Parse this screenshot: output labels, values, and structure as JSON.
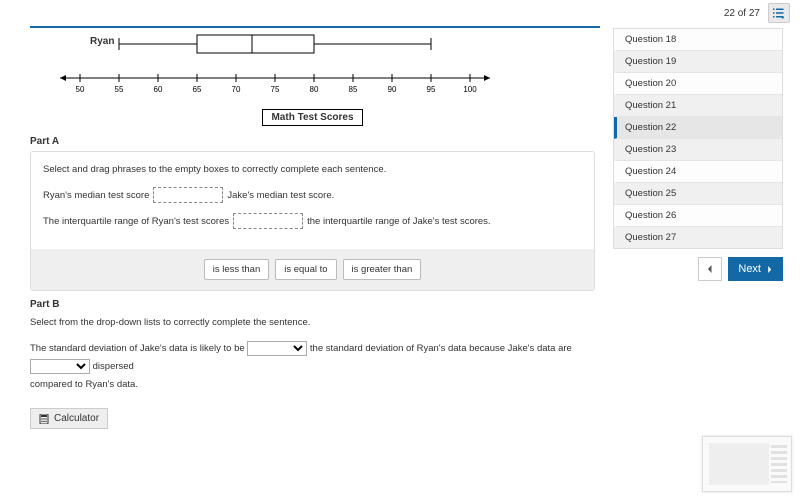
{
  "progress": {
    "current": 22,
    "total": 27,
    "text": "22 of 27"
  },
  "chart_data": {
    "type": "boxplot",
    "title": "Math Test Scores",
    "x_ticks": [
      50,
      55,
      60,
      65,
      70,
      75,
      80,
      85,
      90,
      95,
      100
    ],
    "series": [
      {
        "name": "Ryan",
        "min": 55,
        "q1": 65,
        "median": 72,
        "q3": 80,
        "max": 95
      }
    ]
  },
  "partA": {
    "label": "Part A",
    "instructions": "Select and drag phrases to the empty boxes to correctly complete each sentence.",
    "sentence1_a": "Ryan's median test score",
    "sentence1_b": "Jake's median test score.",
    "sentence2_a": "The interquartile range of Ryan's test scores",
    "sentence2_b": "the interquartile range of Jake's test scores.",
    "phrases": [
      "is less than",
      "is equal to",
      "is greater than"
    ]
  },
  "partB": {
    "label": "Part B",
    "instructions": "Select from the drop-down lists to correctly complete the sentence.",
    "seg1": "The standard deviation of Jake's data is likely to be",
    "seg2": "the standard deviation of Ryan's data because Jake's data are",
    "seg3": "dispersed",
    "seg4": "compared to Ryan's data."
  },
  "calculator_label": "Calculator",
  "questions": [
    {
      "label": "Question 18"
    },
    {
      "label": "Question 19"
    },
    {
      "label": "Question 20"
    },
    {
      "label": "Question 21"
    },
    {
      "label": "Question 22",
      "active": true
    },
    {
      "label": "Question 23"
    },
    {
      "label": "Question 24"
    },
    {
      "label": "Question 25"
    },
    {
      "label": "Question 26"
    },
    {
      "label": "Question 27"
    }
  ],
  "nav": {
    "next": "Next"
  }
}
